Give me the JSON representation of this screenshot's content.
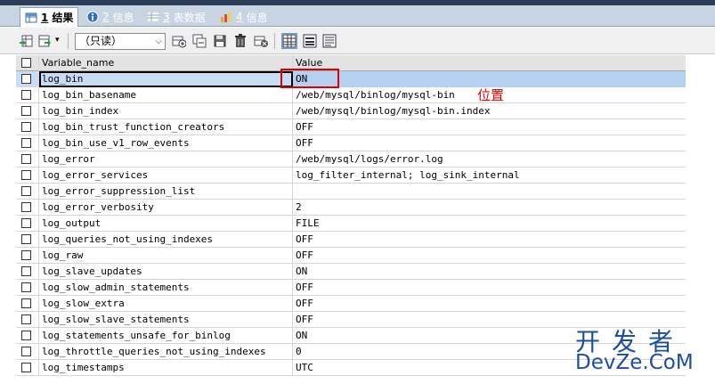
{
  "tabs": [
    {
      "num": "1",
      "label": "结果",
      "active": true
    },
    {
      "num": "2",
      "label": "信息",
      "active": false
    },
    {
      "num": "3",
      "label": "表数据",
      "active": false
    },
    {
      "num": "4",
      "label": "信息",
      "active": false
    }
  ],
  "toolbar": {
    "mode_select_value": "（只读）"
  },
  "grid": {
    "columns": [
      "Variable_name",
      "Value"
    ],
    "rows": [
      {
        "name": "log_bin",
        "value": "ON"
      },
      {
        "name": "log_bin_basename",
        "value": "/web/mysql/binlog/mysql-bin"
      },
      {
        "name": "log_bin_index",
        "value": "/web/mysql/binlog/mysql-bin.index"
      },
      {
        "name": "log_bin_trust_function_creators",
        "value": "OFF"
      },
      {
        "name": "log_bin_use_v1_row_events",
        "value": "OFF"
      },
      {
        "name": "log_error",
        "value": "/web/mysql/logs/error.log"
      },
      {
        "name": "log_error_services",
        "value": "log_filter_internal; log_sink_internal"
      },
      {
        "name": "log_error_suppression_list",
        "value": ""
      },
      {
        "name": "log_error_verbosity",
        "value": "2"
      },
      {
        "name": "log_output",
        "value": "FILE"
      },
      {
        "name": "log_queries_not_using_indexes",
        "value": "OFF"
      },
      {
        "name": "log_raw",
        "value": "OFF"
      },
      {
        "name": "log_slave_updates",
        "value": "ON"
      },
      {
        "name": "log_slow_admin_statements",
        "value": "OFF"
      },
      {
        "name": "log_slow_extra",
        "value": "OFF"
      },
      {
        "name": "log_slow_slave_statements",
        "value": "OFF"
      },
      {
        "name": "log_statements_unsafe_for_binlog",
        "value": "ON"
      },
      {
        "name": "log_throttle_queries_not_using_indexes",
        "value": "0"
      },
      {
        "name": "log_timestamps",
        "value": "UTC"
      }
    ]
  },
  "annotation": {
    "label": "位置"
  },
  "watermark": {
    "line1": "开发者",
    "line2": "DevZe.CoM"
  },
  "colors": {
    "accent_red": "#e00000",
    "watermark_blue": "#1e4f9c",
    "selected_row": "#c8dcf5"
  }
}
